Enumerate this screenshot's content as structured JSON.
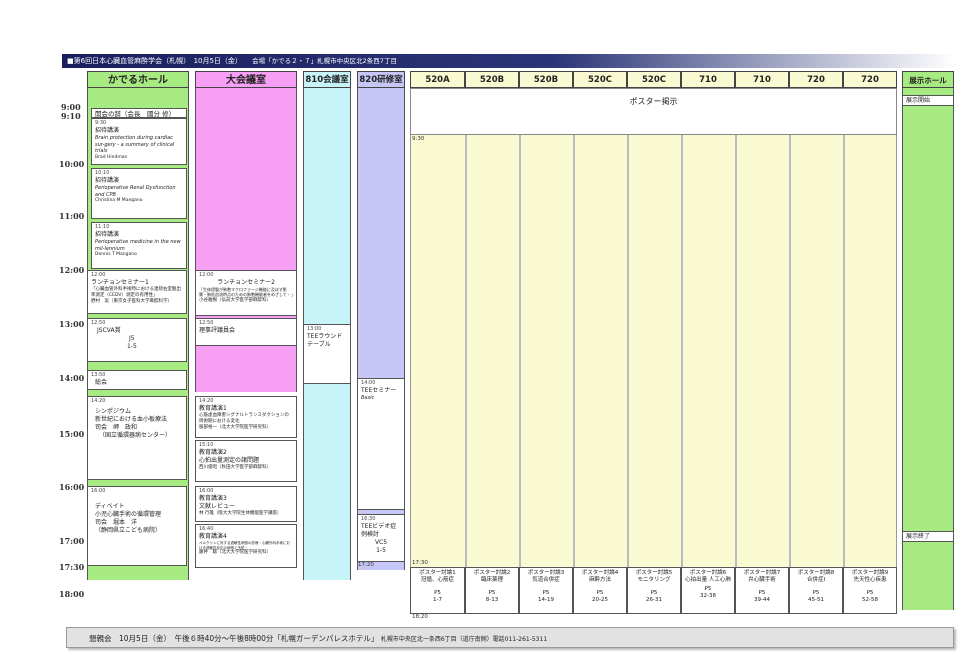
{
  "header": {
    "title": "■第6回日本心臓血管麻酔学会（札幌）　10月5日（金）",
    "venue": "会場「かでる２・７」札幌市中央区北2条西7丁目"
  },
  "times": [
    "9:00",
    "9:10",
    "10:00",
    "11:00",
    "12:00",
    "13:00",
    "14:00",
    "15:00",
    "16:00",
    "17:00",
    "17:30",
    "18:00"
  ],
  "rooms": {
    "kaderu": "かでるホール",
    "taikai": "大会議室",
    "r810": "810会議室",
    "r820": "820研修室",
    "r520a": "520A",
    "r520b1": "520B",
    "r520b2": "520B",
    "r520c1": "520C",
    "r520c2": "520C",
    "r710a": "710",
    "r710b": "710",
    "r720a": "720",
    "r720b": "720",
    "expo": "展示ホール"
  },
  "kaderu": {
    "opening": "開会の辞（会長　國分 修）",
    "e1": {
      "time": "9:30",
      "title": "招待講演",
      "sub": "Brain protection during cardiac sur-gery - a summary of clinical trials",
      "speaker": "Brad Hindman"
    },
    "e2": {
      "time": "10:10",
      "title": "招待講演",
      "sub": "Perioperative Renal Dysfunction and CPB",
      "speaker": "Christina M Mangano"
    },
    "e3": {
      "time": "11:10",
      "title": "招待講演",
      "sub": "Perioperative medicine in the new mil-lennium",
      "speaker": "Dennis T Mangano"
    },
    "e4": {
      "time": "12:00",
      "title": "ランチョンセミナー1",
      "sub": "「心臓血管外科手術時における連続右室駆出率測定（CEDV）測定の有用性」",
      "speaker": "野村　実（東京女子医科大学麻酔科学）"
    },
    "e5": {
      "time": "12:50",
      "title": "JSCVA賞",
      "room": "J5",
      "range": "1-5"
    },
    "e6": {
      "time": "13:50",
      "title": "総会"
    },
    "e7": {
      "time": "14:20",
      "title": "シンポジウム",
      "sub": "新世紀における血小板療法",
      "chair": "司会　岬　政和",
      "aff": "（国立循環器病センター）"
    },
    "e8": {
      "time": "16:00",
      "title": "ディベイト",
      "sub": "小児心臓手術の循環管理",
      "chair": "司会　堀本　洋",
      "aff": "（静岡県立こども病院）"
    }
  },
  "taikai": {
    "e1": {
      "time": "12:00",
      "title": "ランチョンセミナー2",
      "sub": "「生体侵襲が肺胞マクロファージ機能に及ぼす影響・肺低血流時点のための肺胞機能者をめざして・」",
      "speaker": "小谷雅樹（弘前大学医学部麻酔科）"
    },
    "e2": {
      "time": "12:50",
      "title": "理事評議員会"
    },
    "e3": {
      "time": "14:20",
      "title": "教育講演1",
      "sub": "心筋虚血障害シグナルトランスダクションの周術期における変化",
      "speaker": "服部裕一（北大大学院医学研究科）"
    },
    "e4": {
      "time": "15:10",
      "title": "教育講演2",
      "sub": "心拍出量測定の諸問題",
      "speaker": "西川俊昭（秋田大学医学部麻酔科）"
    },
    "e5": {
      "time": "16:00",
      "title": "教育講演3",
      "sub": "文献レビュー",
      "speaker": "林 行雄（阪大大学院生体機能医学講座）"
    },
    "e6": {
      "time": "16:40",
      "title": "教育講演4",
      "sub": "ペルクリンに対する過敏性病態の診療・心臓外科手術における過敏性反応の病態と予防・",
      "speaker": "藤井　聡（北大大学院医学研究科）"
    }
  },
  "r810": {
    "e1": {
      "time": "13:00",
      "title": "TEEラウンドテーブル"
    }
  },
  "r820": {
    "e1": {
      "time": "14:00",
      "title": "TEEセミナー",
      "sub": "Basic"
    },
    "e2": {
      "time": "16:30",
      "title": "TEEビデオ症例検討",
      "room": "VC5",
      "range": "1-5"
    },
    "end": "17:20"
  },
  "poster": {
    "banner": "ポスター掲示",
    "start": "9:30",
    "end_top": "17:30",
    "end_bottom": "18:20",
    "cells": [
      {
        "title": "ポスター討論1",
        "topic": "冠循、心筋症",
        "code": "P5",
        "range": "1-7"
      },
      {
        "title": "ポスター討論2",
        "topic": "臨床薬理",
        "code": "P5",
        "range": "8-13"
      },
      {
        "title": "ポスター討論3",
        "topic": "気道合併症",
        "code": "P5",
        "range": "14-19"
      },
      {
        "title": "ポスター討論4",
        "topic": "麻酔方法",
        "code": "P5",
        "range": "20-25"
      },
      {
        "title": "ポスター討論5",
        "topic": "モニタリング",
        "code": "P5",
        "range": "26-31"
      },
      {
        "title": "ポスター討論6",
        "topic": "心拍出量 人工心肺",
        "code": "P5",
        "range": "32-38"
      },
      {
        "title": "ポスター討論7",
        "topic": "弁心臓手術",
        "code": "P5",
        "range": "39-44"
      },
      {
        "title": "ポスター討論8",
        "topic": "合併症Ⅰ",
        "code": "P5",
        "range": "45-51"
      },
      {
        "title": "ポスター討論9",
        "topic": "先天性心疾患",
        "code": "P5",
        "range": "52-58"
      }
    ]
  },
  "expo": {
    "start": "展示開始",
    "end": "展示終了"
  },
  "footer": {
    "main": "懇親会　10月5日（金）　午後６時40分～午後8時00分「札幌ガーデンパレスホテル」",
    "addr": "札幌市中央区北一条西6丁目（道庁南側）電話011-261-5311"
  },
  "colors": {
    "kaderu": "#a8ea82",
    "taikai": "#f79ef5",
    "r810": "#c6f4f9",
    "r820": "#c6c6f7",
    "poster": "#fafad2",
    "expo": "#a8ea82",
    "header": "#1a1f5e"
  }
}
